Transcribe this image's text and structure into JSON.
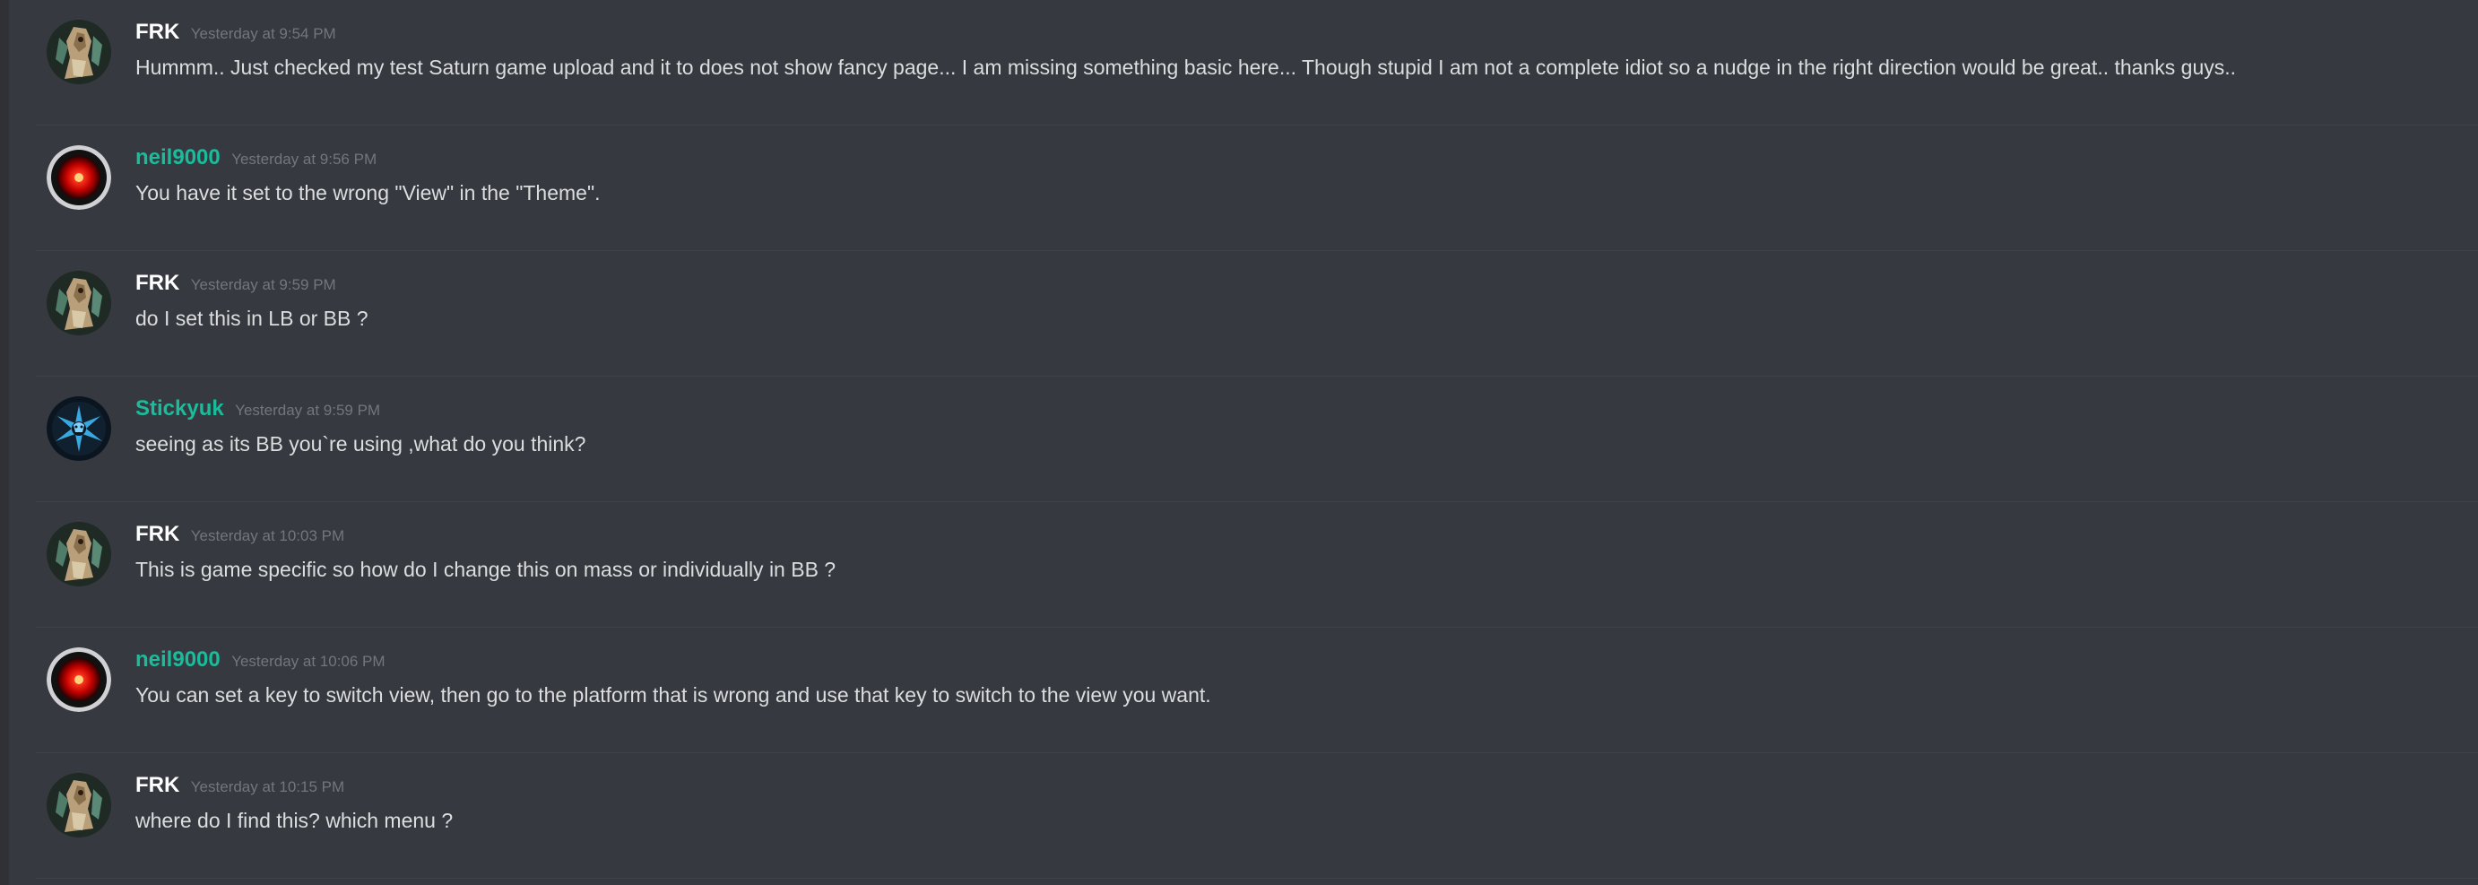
{
  "colors": {
    "background": "#36393f",
    "divider": "#40434a",
    "text": "#dcddde",
    "timestamp": "#72767d",
    "name_white": "#ffffff",
    "name_teal": "#1abc9c"
  },
  "messages": [
    {
      "author": "FRK",
      "author_color": "#ffffff",
      "avatar": "frk-avatar-icon",
      "timestamp": "Yesterday at 9:54 PM",
      "text": "Hummm.. Just checked my test Saturn game upload and it to does not show fancy page... I am missing something basic here... Though stupid I am not a complete idiot so a nudge in the right direction would be great.. thanks guys.."
    },
    {
      "author": "neil9000",
      "author_color": "#1abc9c",
      "avatar": "hal9000-eye-avatar-icon",
      "timestamp": "Yesterday at 9:56 PM",
      "text": "You have it set to the wrong \"View\" in the \"Theme\"."
    },
    {
      "author": "FRK",
      "author_color": "#ffffff",
      "avatar": "frk-avatar-icon",
      "timestamp": "Yesterday at 9:59 PM",
      "text": "do I set this in LB or BB ?"
    },
    {
      "author": "Stickyuk",
      "author_color": "#1abc9c",
      "avatar": "stickyuk-avatar-icon",
      "timestamp": "Yesterday at 9:59 PM",
      "text": "seeing as its BB you`re using ,what do you think?"
    },
    {
      "author": "FRK",
      "author_color": "#ffffff",
      "avatar": "frk-avatar-icon",
      "timestamp": "Yesterday at 10:03 PM",
      "text": "This is game specific so how do I change this on mass or individually in BB ?"
    },
    {
      "author": "neil9000",
      "author_color": "#1abc9c",
      "avatar": "hal9000-eye-avatar-icon",
      "timestamp": "Yesterday at 10:06 PM",
      "text": "You can set a key to switch view, then go to the platform that is wrong and use that key to switch to the view you want."
    },
    {
      "author": "FRK",
      "author_color": "#ffffff",
      "avatar": "frk-avatar-icon",
      "timestamp": "Yesterday at 10:15 PM",
      "text": "where do I find this? which menu ?"
    }
  ]
}
